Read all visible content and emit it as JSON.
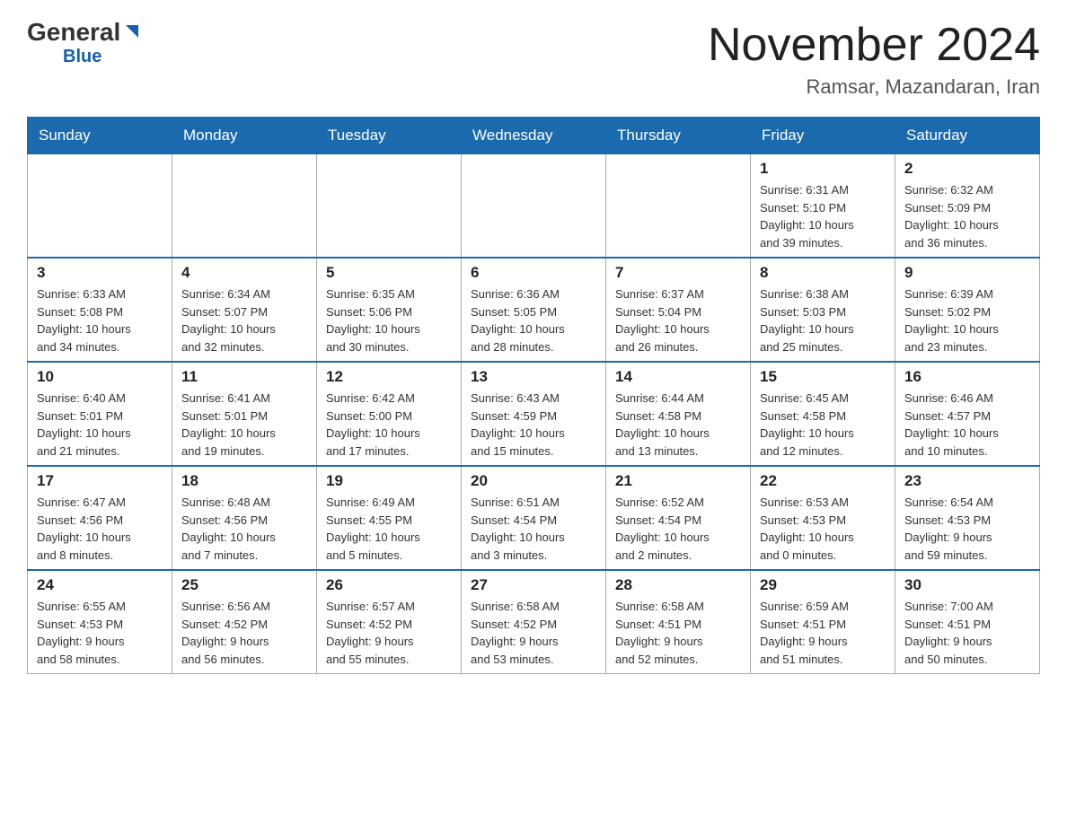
{
  "header": {
    "logo_main": "General",
    "logo_blue": "Blue",
    "title": "November 2024",
    "subtitle": "Ramsar, Mazandaran, Iran"
  },
  "days_of_week": [
    "Sunday",
    "Monday",
    "Tuesday",
    "Wednesday",
    "Thursday",
    "Friday",
    "Saturday"
  ],
  "weeks": [
    {
      "days": [
        {
          "number": "",
          "info": ""
        },
        {
          "number": "",
          "info": ""
        },
        {
          "number": "",
          "info": ""
        },
        {
          "number": "",
          "info": ""
        },
        {
          "number": "",
          "info": ""
        },
        {
          "number": "1",
          "info": "Sunrise: 6:31 AM\nSunset: 5:10 PM\nDaylight: 10 hours\nand 39 minutes."
        },
        {
          "number": "2",
          "info": "Sunrise: 6:32 AM\nSunset: 5:09 PM\nDaylight: 10 hours\nand 36 minutes."
        }
      ]
    },
    {
      "days": [
        {
          "number": "3",
          "info": "Sunrise: 6:33 AM\nSunset: 5:08 PM\nDaylight: 10 hours\nand 34 minutes."
        },
        {
          "number": "4",
          "info": "Sunrise: 6:34 AM\nSunset: 5:07 PM\nDaylight: 10 hours\nand 32 minutes."
        },
        {
          "number": "5",
          "info": "Sunrise: 6:35 AM\nSunset: 5:06 PM\nDaylight: 10 hours\nand 30 minutes."
        },
        {
          "number": "6",
          "info": "Sunrise: 6:36 AM\nSunset: 5:05 PM\nDaylight: 10 hours\nand 28 minutes."
        },
        {
          "number": "7",
          "info": "Sunrise: 6:37 AM\nSunset: 5:04 PM\nDaylight: 10 hours\nand 26 minutes."
        },
        {
          "number": "8",
          "info": "Sunrise: 6:38 AM\nSunset: 5:03 PM\nDaylight: 10 hours\nand 25 minutes."
        },
        {
          "number": "9",
          "info": "Sunrise: 6:39 AM\nSunset: 5:02 PM\nDaylight: 10 hours\nand 23 minutes."
        }
      ]
    },
    {
      "days": [
        {
          "number": "10",
          "info": "Sunrise: 6:40 AM\nSunset: 5:01 PM\nDaylight: 10 hours\nand 21 minutes."
        },
        {
          "number": "11",
          "info": "Sunrise: 6:41 AM\nSunset: 5:01 PM\nDaylight: 10 hours\nand 19 minutes."
        },
        {
          "number": "12",
          "info": "Sunrise: 6:42 AM\nSunset: 5:00 PM\nDaylight: 10 hours\nand 17 minutes."
        },
        {
          "number": "13",
          "info": "Sunrise: 6:43 AM\nSunset: 4:59 PM\nDaylight: 10 hours\nand 15 minutes."
        },
        {
          "number": "14",
          "info": "Sunrise: 6:44 AM\nSunset: 4:58 PM\nDaylight: 10 hours\nand 13 minutes."
        },
        {
          "number": "15",
          "info": "Sunrise: 6:45 AM\nSunset: 4:58 PM\nDaylight: 10 hours\nand 12 minutes."
        },
        {
          "number": "16",
          "info": "Sunrise: 6:46 AM\nSunset: 4:57 PM\nDaylight: 10 hours\nand 10 minutes."
        }
      ]
    },
    {
      "days": [
        {
          "number": "17",
          "info": "Sunrise: 6:47 AM\nSunset: 4:56 PM\nDaylight: 10 hours\nand 8 minutes."
        },
        {
          "number": "18",
          "info": "Sunrise: 6:48 AM\nSunset: 4:56 PM\nDaylight: 10 hours\nand 7 minutes."
        },
        {
          "number": "19",
          "info": "Sunrise: 6:49 AM\nSunset: 4:55 PM\nDaylight: 10 hours\nand 5 minutes."
        },
        {
          "number": "20",
          "info": "Sunrise: 6:51 AM\nSunset: 4:54 PM\nDaylight: 10 hours\nand 3 minutes."
        },
        {
          "number": "21",
          "info": "Sunrise: 6:52 AM\nSunset: 4:54 PM\nDaylight: 10 hours\nand 2 minutes."
        },
        {
          "number": "22",
          "info": "Sunrise: 6:53 AM\nSunset: 4:53 PM\nDaylight: 10 hours\nand 0 minutes."
        },
        {
          "number": "23",
          "info": "Sunrise: 6:54 AM\nSunset: 4:53 PM\nDaylight: 9 hours\nand 59 minutes."
        }
      ]
    },
    {
      "days": [
        {
          "number": "24",
          "info": "Sunrise: 6:55 AM\nSunset: 4:53 PM\nDaylight: 9 hours\nand 58 minutes."
        },
        {
          "number": "25",
          "info": "Sunrise: 6:56 AM\nSunset: 4:52 PM\nDaylight: 9 hours\nand 56 minutes."
        },
        {
          "number": "26",
          "info": "Sunrise: 6:57 AM\nSunset: 4:52 PM\nDaylight: 9 hours\nand 55 minutes."
        },
        {
          "number": "27",
          "info": "Sunrise: 6:58 AM\nSunset: 4:52 PM\nDaylight: 9 hours\nand 53 minutes."
        },
        {
          "number": "28",
          "info": "Sunrise: 6:58 AM\nSunset: 4:51 PM\nDaylight: 9 hours\nand 52 minutes."
        },
        {
          "number": "29",
          "info": "Sunrise: 6:59 AM\nSunset: 4:51 PM\nDaylight: 9 hours\nand 51 minutes."
        },
        {
          "number": "30",
          "info": "Sunrise: 7:00 AM\nSunset: 4:51 PM\nDaylight: 9 hours\nand 50 minutes."
        }
      ]
    }
  ]
}
